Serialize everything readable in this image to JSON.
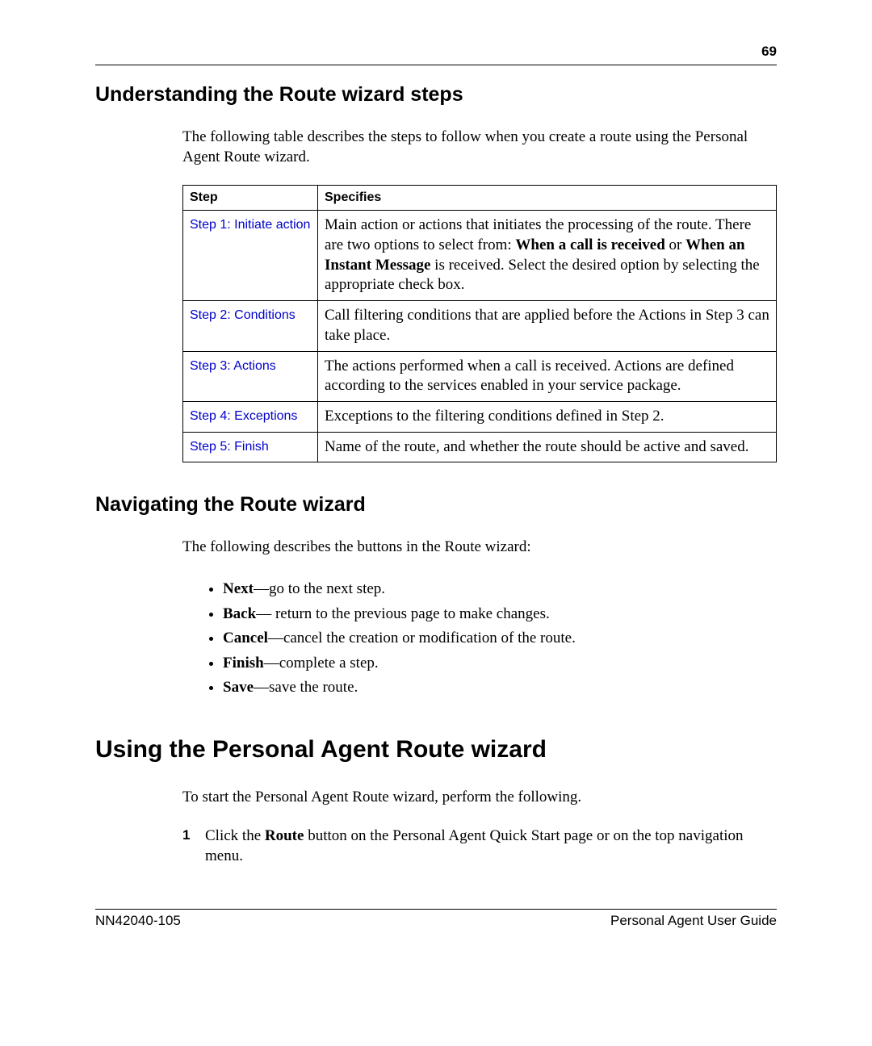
{
  "pageNumber": "69",
  "section1": {
    "heading": "Understanding the Route wizard steps",
    "intro": "The following table describes the steps to follow when you create a route using the Personal Agent Route wizard.",
    "table": {
      "headers": {
        "step": "Step",
        "spec": "Specifies"
      },
      "rows": [
        {
          "link": "Step 1: Initiate action",
          "spec_pre": "Main action or actions that initiates the processing of the route. There are two options to select from: ",
          "spec_bold1": "When a call is received",
          "spec_mid": " or ",
          "spec_bold2": "When an Instant Message",
          "spec_post": " is received. Select the desired option by selecting the appropriate check box."
        },
        {
          "link": "Step 2: Conditions",
          "spec": "Call filtering conditions that are applied before the Actions in Step 3 can take place."
        },
        {
          "link": "Step 3: Actions",
          "spec": "The actions performed when a call is received. Actions are defined according to the services enabled in your service package."
        },
        {
          "link": "Step 4: Exceptions",
          "spec": "Exceptions to the filtering conditions defined in Step 2."
        },
        {
          "link": "Step 5: Finish",
          "spec": "Name of the route, and whether the route should be active and saved."
        }
      ]
    }
  },
  "section2": {
    "heading": "Navigating the Route wizard",
    "intro": "The following describes the buttons in the Route wizard:",
    "items": [
      {
        "bold": "Next",
        "rest": "—go to the next step."
      },
      {
        "bold": "Back",
        "rest": "— return to the previous page to make changes."
      },
      {
        "bold": "Cancel",
        "rest": "—cancel the creation or modification of the route."
      },
      {
        "bold": "Finish",
        "rest": "—complete a step."
      },
      {
        "bold": "Save",
        "rest": "—save the route."
      }
    ]
  },
  "section3": {
    "heading": "Using the Personal Agent Route wizard",
    "intro": "To start the Personal Agent Route wizard, perform the following.",
    "steps": [
      {
        "num": "1",
        "pre": "Click the ",
        "bold": "Route",
        "post": " button on the Personal Agent Quick Start page or on the top navigation menu."
      }
    ]
  },
  "footer": {
    "left": "NN42040-105",
    "right": "Personal Agent User Guide"
  }
}
